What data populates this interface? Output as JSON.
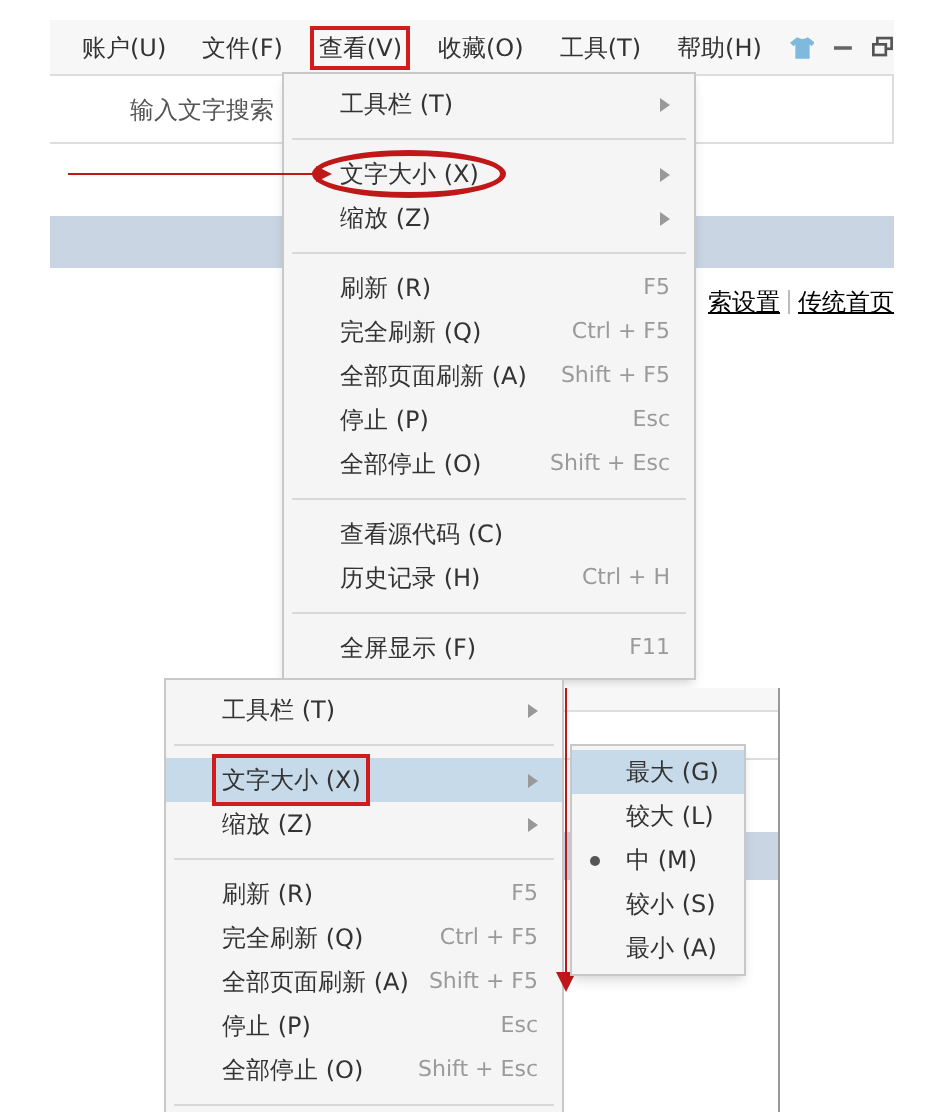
{
  "top": {
    "menubar": [
      {
        "label": "账户(U)",
        "selected": false
      },
      {
        "label": "文件(F)",
        "selected": false
      },
      {
        "label": "查看(V)",
        "selected": true
      },
      {
        "label": "收藏(O)",
        "selected": false
      },
      {
        "label": "工具(T)",
        "selected": false
      },
      {
        "label": "帮助(H)",
        "selected": false
      }
    ],
    "search": {
      "placeholder": "输入文字搜索"
    },
    "links": [
      "索设置",
      "传统首页"
    ],
    "menu": [
      {
        "kind": "item",
        "label": "工具栏 (T)",
        "submenu": true,
        "annotated": false
      },
      {
        "kind": "separator"
      },
      {
        "kind": "item",
        "label": "文字大小 (X)",
        "submenu": true,
        "annotated": true
      },
      {
        "kind": "item",
        "label": "缩放 (Z)",
        "submenu": true,
        "annotated": false
      },
      {
        "kind": "separator"
      },
      {
        "kind": "item",
        "label": "刷新 (R)",
        "shortcut": "F5",
        "annotated": false
      },
      {
        "kind": "item",
        "label": "完全刷新 (Q)",
        "shortcut": "Ctrl + F5",
        "annotated": false
      },
      {
        "kind": "item",
        "label": "全部页面刷新 (A)",
        "shortcut": "Shift + F5",
        "annotated": false
      },
      {
        "kind": "item",
        "label": "停止 (P)",
        "shortcut": "Esc",
        "annotated": false
      },
      {
        "kind": "item",
        "label": "全部停止 (O)",
        "shortcut": "Shift + Esc",
        "annotated": false
      },
      {
        "kind": "separator"
      },
      {
        "kind": "item",
        "label": "查看源代码 (C)",
        "annotated": false
      },
      {
        "kind": "item",
        "label": "历史记录 (H)",
        "shortcut": "Ctrl + H",
        "annotated": false
      },
      {
        "kind": "separator"
      },
      {
        "kind": "item",
        "label": "全屏显示 (F)",
        "shortcut": "F11",
        "annotated": false
      }
    ]
  },
  "bottom": {
    "menu": [
      {
        "kind": "item",
        "label": "工具栏 (T)",
        "submenu": true,
        "highlighted": false,
        "annotated": false
      },
      {
        "kind": "separator"
      },
      {
        "kind": "item",
        "label": "文字大小 (X)",
        "submenu": true,
        "highlighted": true,
        "annotated": true
      },
      {
        "kind": "item",
        "label": "缩放 (Z)",
        "submenu": true,
        "highlighted": false,
        "annotated": false
      },
      {
        "kind": "separator"
      },
      {
        "kind": "item",
        "label": "刷新 (R)",
        "shortcut": "F5",
        "highlighted": false,
        "annotated": false
      },
      {
        "kind": "item",
        "label": "完全刷新 (Q)",
        "shortcut": "Ctrl + F5",
        "highlighted": false,
        "annotated": false
      },
      {
        "kind": "item",
        "label": "全部页面刷新 (A)",
        "shortcut": "Shift + F5",
        "highlighted": false,
        "annotated": false
      },
      {
        "kind": "item",
        "label": "停止 (P)",
        "shortcut": "Esc",
        "highlighted": false,
        "annotated": false
      },
      {
        "kind": "item",
        "label": "全部停止 (O)",
        "shortcut": "Shift + Esc",
        "highlighted": false,
        "annotated": false
      },
      {
        "kind": "separator"
      }
    ],
    "submenu": [
      {
        "label": "最大 (G)",
        "highlighted": true,
        "checked": false
      },
      {
        "label": "较大 (L)",
        "highlighted": false,
        "checked": false
      },
      {
        "label": "中 (M)",
        "highlighted": false,
        "checked": true
      },
      {
        "label": "较小 (S)",
        "highlighted": false,
        "checked": false
      },
      {
        "label": "最小 (A)",
        "highlighted": false,
        "checked": false
      }
    ]
  }
}
